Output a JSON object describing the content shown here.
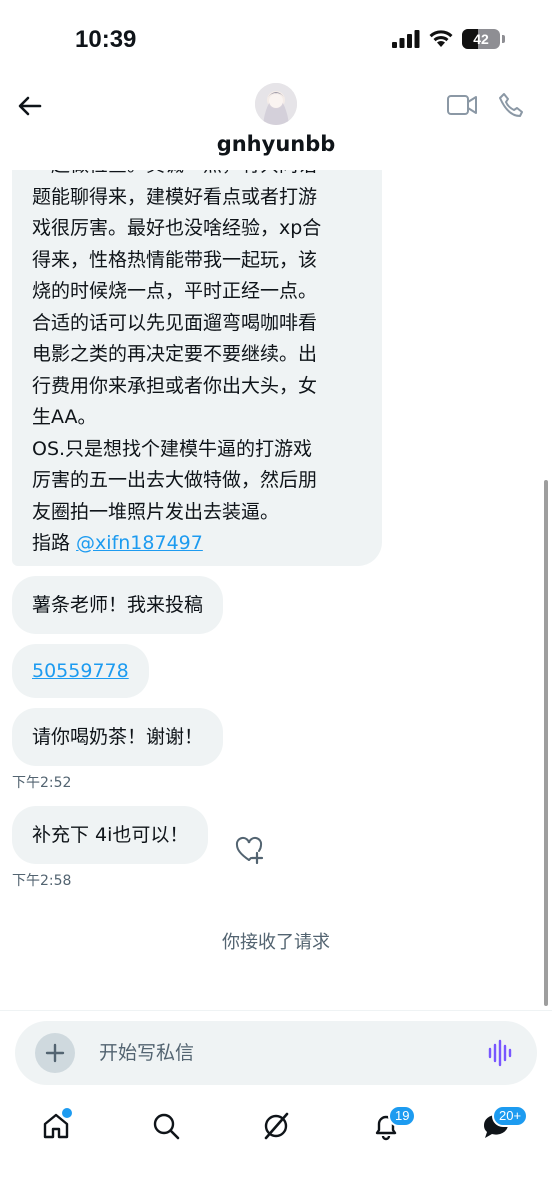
{
  "status_bar": {
    "time": "10:39",
    "battery_level": "42",
    "battery_fraction": 0.42
  },
  "header": {
    "username": "gnhyunbb",
    "icons": [
      "back-arrow-icon",
      "video-call-icon",
      "phone-icon"
    ]
  },
  "messages": {
    "first_bubble_lines": [
      "一起做检查。真诚一点，有共同话",
      "题能聊得来，建模好看点或者打游",
      "戏很厉害。最好也没啥经验，xp合",
      "得来，性格热情能带我一起玩，该",
      "烧的时候烧一点，平时正经一点。",
      "合适的话可以先见面遛弯喝咖啡看",
      "电影之类的再决定要不要继续。出",
      "行费用你来承担或者你出大头，女",
      "生AA。",
      "OS.只是想找个建模牛逼的打游戏",
      "厉害的五一出去大做特做，然后朋",
      "友圈拍一堆照片发出去装逼。"
    ],
    "first_bubble_last_prefix": "指路 ",
    "first_bubble_mention": "@xifn187497",
    "msg1": "薯条老师！我来投稿",
    "msg2_link": "50559778",
    "msg3": "请你喝奶茶！谢谢！",
    "time1": "下午2:52",
    "msg4": "补充下 4i也可以！",
    "time2": "下午2:58",
    "system_notice": "你接收了请求"
  },
  "composer": {
    "placeholder": "开始写私信"
  },
  "tabbar": {
    "items": [
      "home-icon",
      "search-icon",
      "grok-icon",
      "notifications-icon",
      "messages-icon"
    ],
    "notifications_badge": "19",
    "messages_badge": "20+"
  },
  "colors": {
    "accent": "#1d9bf0",
    "bubble": "#eff3f4",
    "secondary_text": "#536471"
  }
}
